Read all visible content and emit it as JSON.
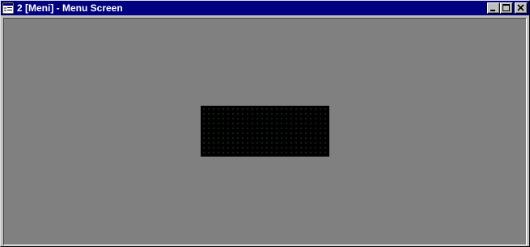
{
  "window": {
    "title": "2 [Meni] - Menu Screen",
    "icon": "app-window-icon",
    "controls": {
      "minimize": "minimize-icon",
      "maximize": "maximize-icon",
      "close": "close-icon"
    }
  },
  "colors": {
    "titlebar": "#000080",
    "client_background": "#808080",
    "panel_background": "#000000"
  }
}
